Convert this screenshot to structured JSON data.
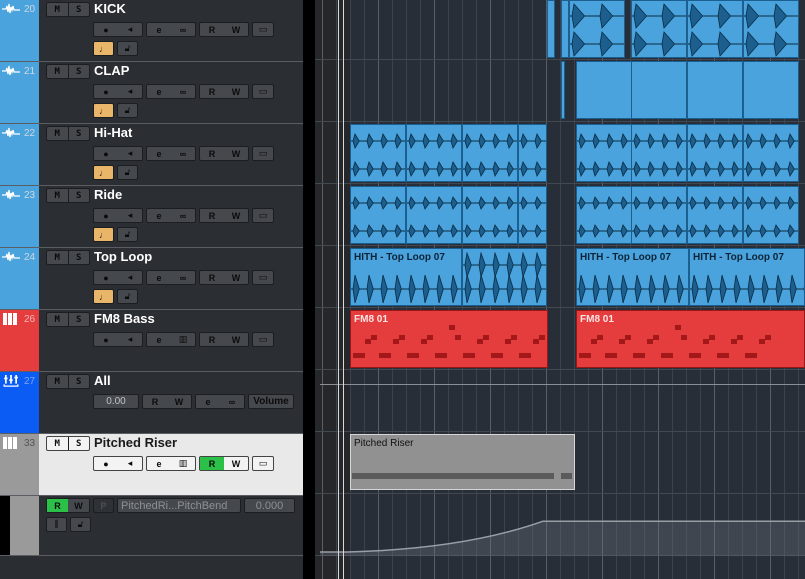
{
  "tracks": [
    {
      "num": "20",
      "name": "KICK",
      "type": "audio",
      "color": "#4aa3dc",
      "mute": "M",
      "solo": "S",
      "buttons": [
        "record",
        "monitor",
        "edit",
        "link",
        "read",
        "write",
        "lanes"
      ],
      "row2": [
        "musical-mode",
        "lock"
      ]
    },
    {
      "num": "21",
      "name": "CLAP",
      "type": "audio",
      "color": "#4aa3dc",
      "mute": "M",
      "solo": "S",
      "buttons": [
        "record",
        "monitor",
        "edit",
        "link",
        "read",
        "write",
        "lanes"
      ],
      "row2": [
        "musical-mode",
        "lock"
      ]
    },
    {
      "num": "22",
      "name": "Hi-Hat",
      "type": "audio",
      "color": "#4aa3dc",
      "mute": "M",
      "solo": "S",
      "buttons": [
        "record",
        "monitor",
        "edit",
        "link",
        "read",
        "write",
        "lanes"
      ],
      "row2": [
        "musical-mode",
        "lock"
      ]
    },
    {
      "num": "23",
      "name": "Ride",
      "type": "audio",
      "color": "#4aa3dc",
      "mute": "M",
      "solo": "S",
      "buttons": [
        "record",
        "monitor",
        "edit",
        "link",
        "read",
        "write",
        "lanes"
      ],
      "row2": [
        "musical-mode",
        "lock"
      ]
    },
    {
      "num": "24",
      "name": "Top Loop",
      "type": "audio",
      "color": "#4aa3dc",
      "mute": "M",
      "solo": "S",
      "buttons": [
        "record",
        "monitor",
        "edit",
        "link",
        "read",
        "write",
        "lanes"
      ],
      "row2": [
        "musical-mode",
        "lock"
      ]
    },
    {
      "num": "26",
      "name": "FM8 Bass",
      "type": "instrument",
      "color": "#e53d3e",
      "mute": "M",
      "solo": "S",
      "buttons": [
        "record",
        "monitor",
        "edit",
        "instrument",
        "read",
        "write",
        "lanes"
      ]
    },
    {
      "num": "27",
      "name": "All",
      "type": "vca",
      "color": "#0a5cf5",
      "mute": "M",
      "solo": "S",
      "value": "0.00",
      "volume_label": "Volume"
    },
    {
      "num": "33",
      "name": "Pitched Riser",
      "type": "instrument",
      "color": "#9a9a9a",
      "mute": "M",
      "solo": "S",
      "selected": true,
      "buttons": [
        "record",
        "monitor",
        "edit",
        "instrument",
        "read-active",
        "write",
        "lanes"
      ]
    }
  ],
  "automation_lane": {
    "read": "R",
    "write": "W",
    "punch": "P",
    "parameter": "PitchedRi...PitchBend",
    "value": "0.000"
  },
  "labels": {
    "read": "R",
    "write": "W"
  },
  "parts": {
    "top_loop_1": "HITH - Top Loop 07",
    "top_loop_2": "HITH - Top Loop 07",
    "top_loop_3": "HITH - Top Loop 07",
    "fm8_1": "FM8 01",
    "fm8_2": "FM8 01",
    "riser": "Pitched Riser"
  },
  "automation_curve": {
    "start_value": 0.0,
    "end_value": 0.35
  }
}
